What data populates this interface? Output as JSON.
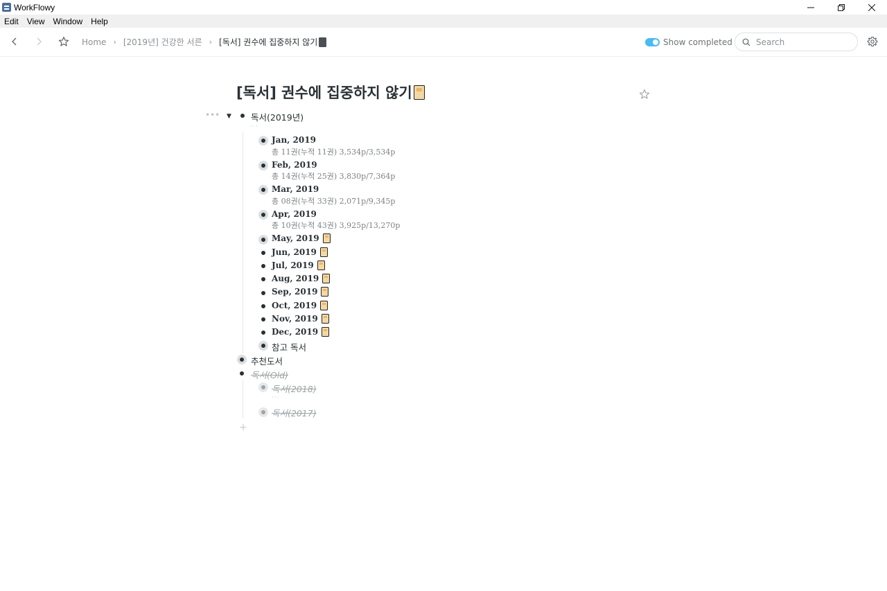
{
  "window": {
    "title": "WorkFlowy",
    "controls": [
      "minimize",
      "restore",
      "close"
    ]
  },
  "menu": [
    "Edit",
    "View",
    "Window",
    "Help"
  ],
  "toolbar": {
    "breadcrumbs": [
      "Home",
      "[2019년] 건강한 서른"
    ],
    "current": "[독서] 권수에 집중하지 않기",
    "show_completed_label": "Show completed",
    "show_completed": true,
    "search_placeholder": "Search",
    "accent_color": "#49baf2"
  },
  "page": {
    "title": "[독서] 권수에 집중하지 않기",
    "title_icon": "book-emoji",
    "root": {
      "label": "독서(2019년)",
      "months": [
        {
          "label": "Jan, 2019",
          "note": "총 11권(누적 11권) 3,534p/3,534p",
          "collapsed": true,
          "emoji": false
        },
        {
          "label": "Feb, 2019",
          "note": "총 14권(누적 25권) 3,830p/7,364p",
          "collapsed": true,
          "emoji": false
        },
        {
          "label": "Mar, 2019",
          "note": "총 08권(누적 33권) 2,071p/9,345p",
          "collapsed": true,
          "emoji": false
        },
        {
          "label": "Apr, 2019",
          "note": "총 10권(누적 43권) 3,925p/13,270p",
          "collapsed": true,
          "emoji": false
        },
        {
          "label": "May, 2019",
          "note": "",
          "collapsed": true,
          "emoji": true
        },
        {
          "label": "Jun, 2019",
          "note": "",
          "collapsed": false,
          "emoji": true
        },
        {
          "label": "Jul, 2019",
          "note": "",
          "collapsed": false,
          "emoji": true
        },
        {
          "label": "Aug, 2019",
          "note": "",
          "collapsed": false,
          "emoji": true
        },
        {
          "label": "Sep, 2019",
          "note": "",
          "collapsed": false,
          "emoji": true
        },
        {
          "label": "Oct, 2019",
          "note": "",
          "collapsed": false,
          "emoji": true
        },
        {
          "label": "Nov, 2019",
          "note": "",
          "collapsed": false,
          "emoji": true
        },
        {
          "label": "Dec, 2019",
          "note": "",
          "collapsed": false,
          "emoji": true
        }
      ],
      "reference": "참고 독서"
    },
    "recommended": "추천도서",
    "old": {
      "label": "독서(Old)",
      "children": [
        "독서(2018)",
        "독서(2017)"
      ]
    }
  }
}
